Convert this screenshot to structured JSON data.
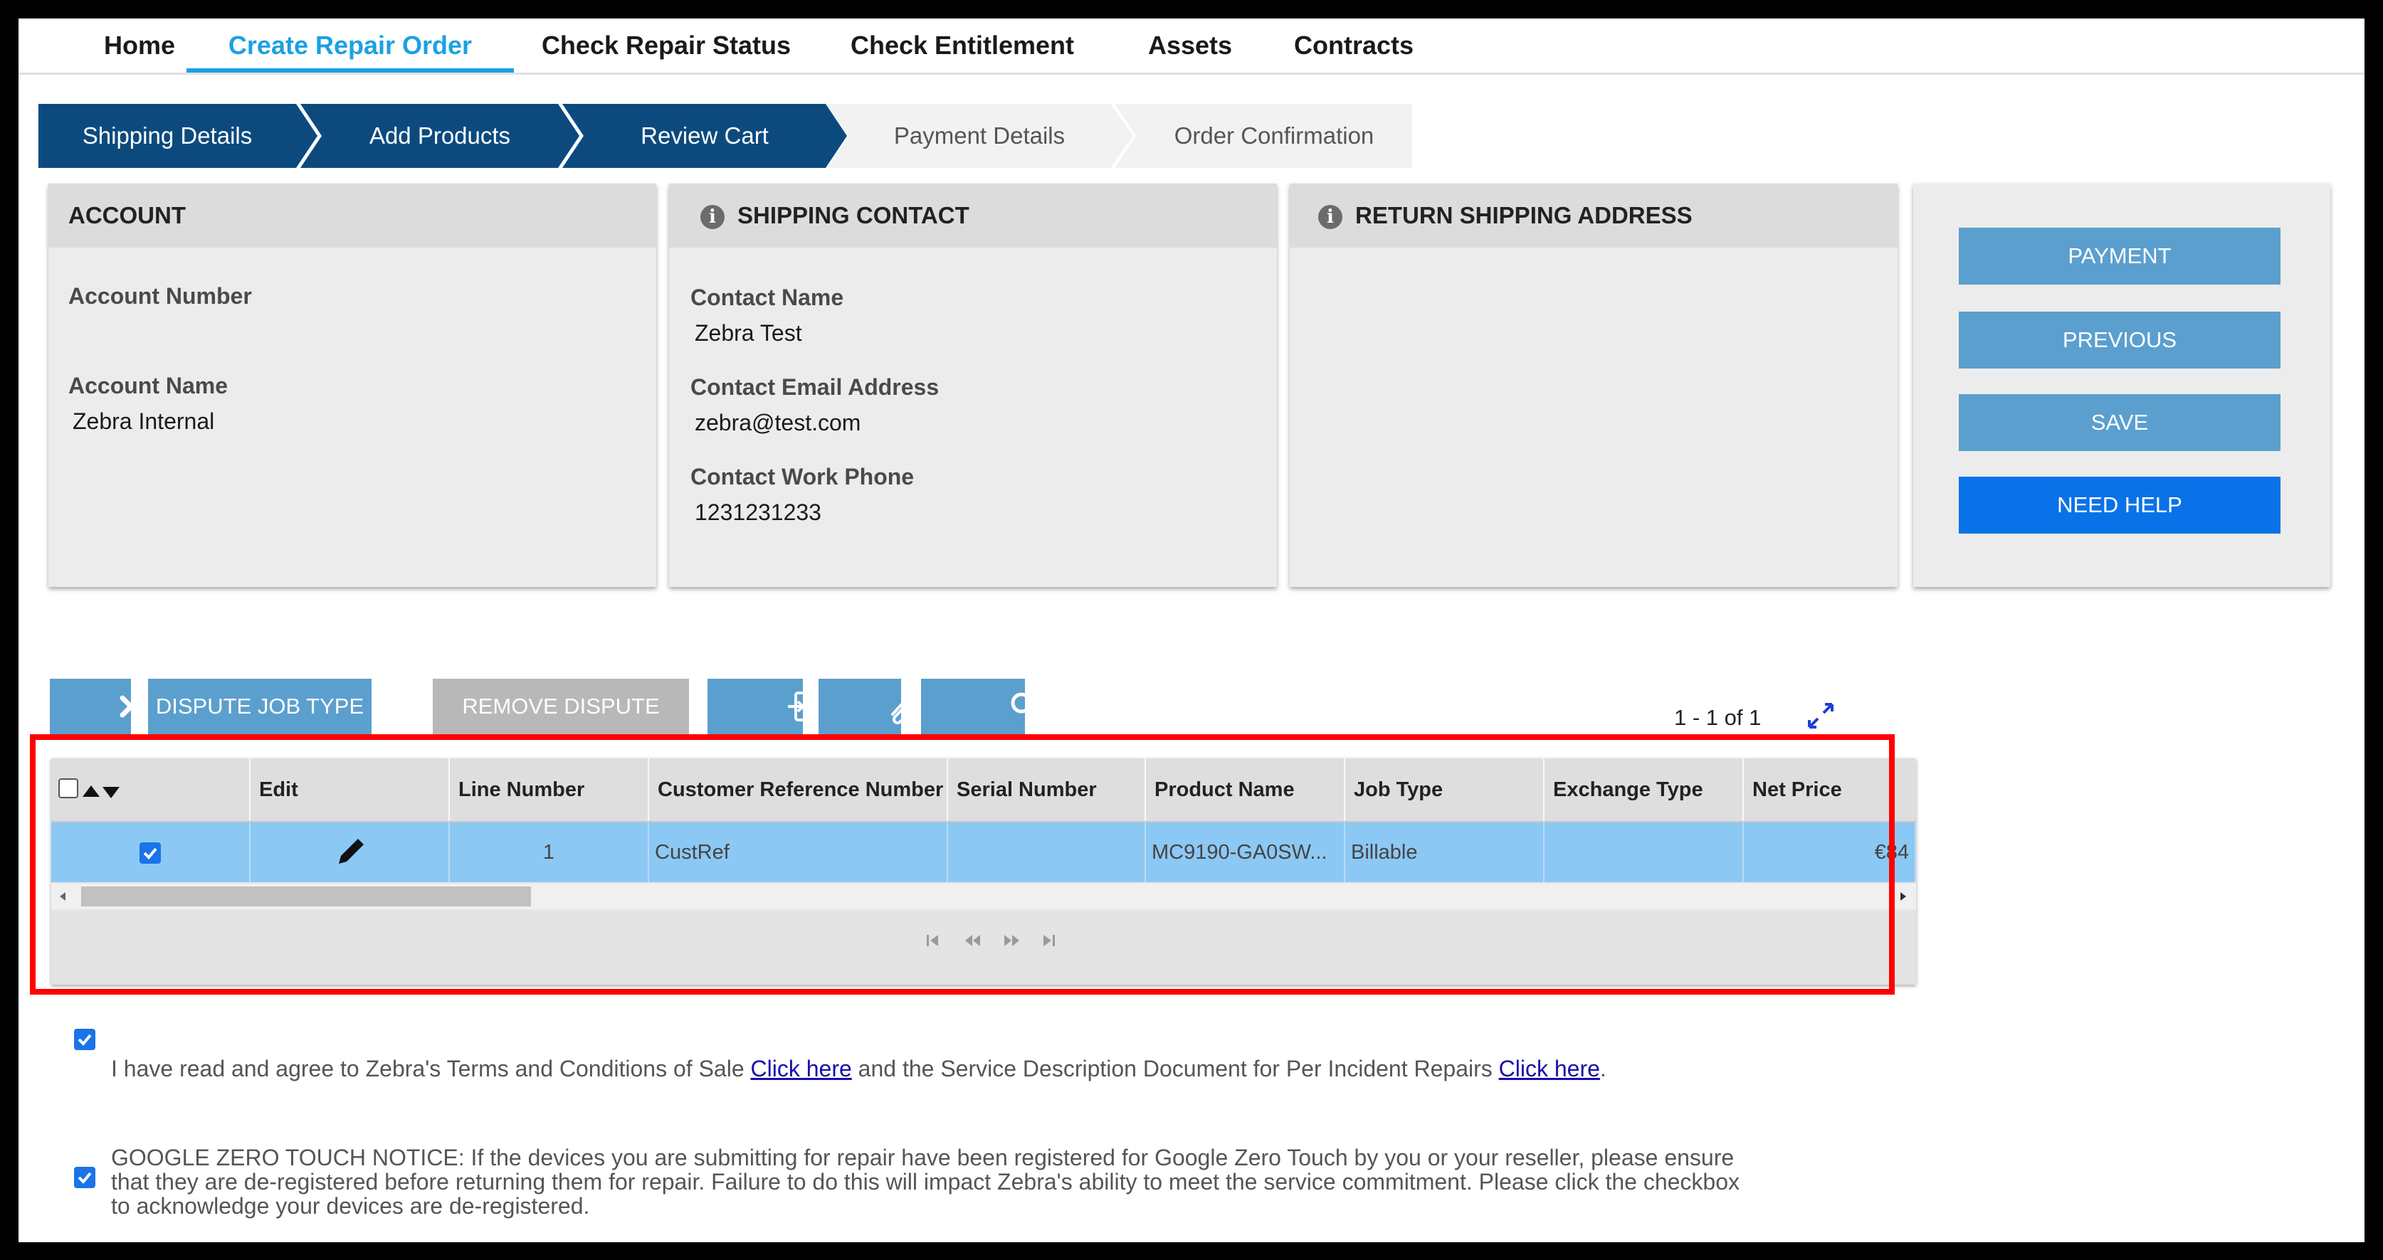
{
  "nav": {
    "tabs": [
      {
        "label": "Home"
      },
      {
        "label": "Create Repair Order"
      },
      {
        "label": "Check Repair Status"
      },
      {
        "label": "Check Entitlement"
      },
      {
        "label": "Assets"
      },
      {
        "label": "Contracts"
      }
    ],
    "active_index": 1
  },
  "stepper": {
    "steps": [
      {
        "label": "Shipping Details",
        "state": "complete"
      },
      {
        "label": "Add Products",
        "state": "complete"
      },
      {
        "label": "Review Cart",
        "state": "current"
      },
      {
        "label": "Payment Details",
        "state": "pending"
      },
      {
        "label": "Order Confirmation",
        "state": "pending"
      }
    ]
  },
  "account": {
    "title": "ACCOUNT",
    "number_label": "Account Number",
    "number_value": "",
    "name_label": "Account Name",
    "name_value": "Zebra Internal"
  },
  "shipping_contact": {
    "title": "SHIPPING CONTACT",
    "name_label": "Contact Name",
    "name_value": "Zebra Test",
    "email_label": "Contact Email Address",
    "email_value": "zebra@test.com",
    "phone_label": "Contact Work Phone",
    "phone_value": "1231231233"
  },
  "return_address": {
    "title": "RETURN SHIPPING ADDRESS"
  },
  "actions": {
    "payment": "PAYMENT",
    "previous": "PREVIOUS",
    "save": "SAVE",
    "help": "NEED HELP"
  },
  "toolbar": {
    "dispute": "DISPUTE JOB TYPE",
    "remove_dispute": "REMOVE DISPUTE",
    "pager_text": "1 - 1 of 1"
  },
  "grid": {
    "columns": [
      "Edit",
      "Line Number",
      "Customer Reference Number",
      "Serial Number",
      "Product Name",
      "Job Type",
      "Exchange Type",
      "Net Price"
    ],
    "rows": [
      {
        "line": "1",
        "ref": "CustRef",
        "serial": "",
        "product": "MC9190-GA0SW...",
        "job_type": "Billable",
        "exchange": "",
        "net_price": "€84"
      }
    ]
  },
  "terms": {
    "text_a": "I have read and agree to Zebra's Terms and Conditions of Sale ",
    "link_a": "Click here",
    "text_b": " and the Service Description Document for Per Incident Repairs ",
    "link_b": "Click here",
    "text_c": "."
  },
  "zero_touch": {
    "line1": "GOOGLE ZERO TOUCH NOTICE: If the devices you are submitting for repair have been registered for Google Zero Touch by you or your reseller, please ensure",
    "line2": "that they are de-registered before returning them for repair. Failure to do this will impact Zebra's ability to meet the service commitment. Please click the checkbox",
    "line3": "to acknowledge your devices are de-registered."
  },
  "colors": {
    "step_complete": "#0c4a7e",
    "step_pending": "#f2f2f2",
    "action_button": "#5b9fce",
    "help_button": "#0a72e8",
    "row_selected": "#8cc8f4",
    "highlight_border": "#ff0000"
  }
}
